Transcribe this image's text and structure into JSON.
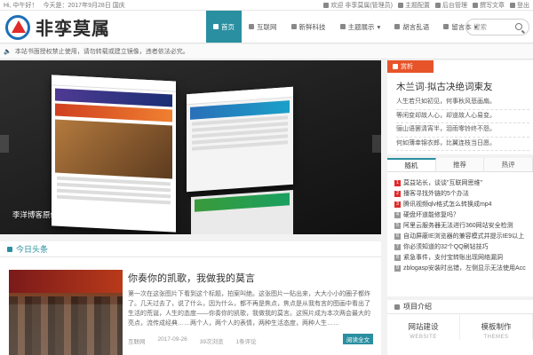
{
  "topbar": {
    "greeting": "Hi, 中午好！",
    "date": "今天是：2017年9月28日 国庆",
    "welcome": "欢迎 非孪莫属(管理员)",
    "theme_settings": "主题配置",
    "admin": "后台管理",
    "post": "撰写文章",
    "logout": "登出"
  },
  "header": {
    "logo_text": "非孪莫属",
    "nav": [
      {
        "label": "首页",
        "icon": "home-icon"
      },
      {
        "label": "互联网",
        "icon": "globe-icon"
      },
      {
        "label": "新鲜科技",
        "icon": "chip-icon"
      },
      {
        "label": "主题展示",
        "icon": "grid-icon"
      },
      {
        "label": "胡言乱语",
        "icon": "chat-icon"
      },
      {
        "label": "留言本",
        "icon": "book-icon"
      }
    ],
    "search_placeholder": "搜索"
  },
  "notice": "本站书面授权禁止使用，请勿转载或建立镜像，违者依法必究。",
  "slider": {
    "caption": "李洋博客原创Inflect主题"
  },
  "today": {
    "title": "今日头条",
    "article": {
      "title": "你奏你的凯歌，我做我的莫言",
      "desc": "第一次在这张图片下看到这个标题，拍案叫绝。这张图片一贴出来，大大小小的圈子都炸了。几天过去了，说了什么，因为什么，都不再是焦点，焦点是从我有言的图画中看出了生活的荒诞，人生的态度——你奏你的凯歌，我做我的莫言。这照片成为本次两会最大的亮点，流传成经典……两个人，两个人的表情，两种生活态度，两种人生……",
      "category": "互联网",
      "date": "2017-09-26",
      "views": "39次浏览",
      "comments": "1条评论",
      "read_more": "阅读全文"
    }
  },
  "ad": {
    "badge": "赏析",
    "title": "木兰词·拟古决绝词柬友",
    "lines": [
      "人生若只如初见，何事秋风悲画扇。",
      "等闲变却故人心，却道故人心易变。",
      "骊山语罢清宵半，泪雨零铃终不怨。",
      "何如薄幸锦衣郎，比翼连枝当日愿。"
    ]
  },
  "tabs": [
    "随机",
    "推荐",
    "热评"
  ],
  "random_list": [
    "莫益站长，谈谈\"互联网思维\"",
    "播客寻找外链的5个办法",
    "腾讯视频qlv格式怎么转换成mp4",
    "硬盘坏道能修复吗？",
    "阿里云服务器无法进行360网站安全检测",
    "自动屏蔽IE浏览器的兼容模式并提示IE9以上",
    "你必须知道的32个QQ刷钻技巧",
    "紧急事件，支付宝转账出现网络漏洞",
    "zblogasp安装时出错，左侧显示无法使用Acc"
  ],
  "project": {
    "title": "项目介绍",
    "items": [
      {
        "title": "网站建设",
        "sub": "WEBSITE"
      },
      {
        "title": "模板制作",
        "sub": "THEMES"
      }
    ]
  }
}
